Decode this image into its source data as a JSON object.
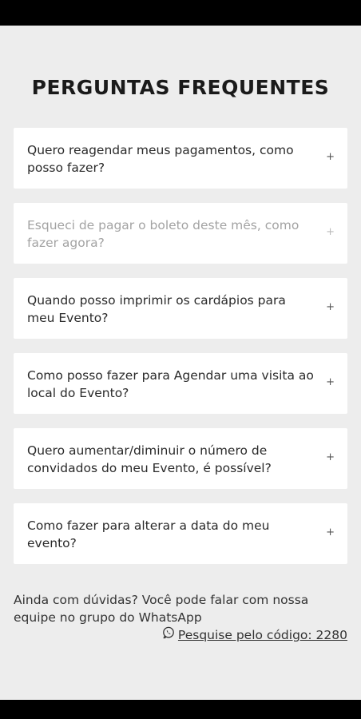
{
  "title": "PERGUNTAS FREQUENTES",
  "faqs": [
    {
      "question": "Quero reagendar meus pagamentos, como posso fazer?",
      "icon": "+"
    },
    {
      "question": "Esqueci de pagar o boleto deste mês, como fazer agora?",
      "icon": "+"
    },
    {
      "question": "Quando posso imprimir os cardápios para meu Evento?",
      "icon": "+"
    },
    {
      "question": "Como posso fazer para Agendar uma visita ao local do Evento?",
      "icon": "+"
    },
    {
      "question": "Quero aumentar/diminuir o número de convidados do meu Evento, é possível?",
      "icon": "+"
    },
    {
      "question": "Como fazer para alterar a data do meu evento?",
      "icon": "+"
    }
  ],
  "footer": {
    "text": "Ainda com dúvidas? Você pode falar com nossa equipe no grupo do WhatsApp",
    "link_label": "Pesquise pelo código: 2280",
    "link_icon": "whatsapp-icon"
  }
}
